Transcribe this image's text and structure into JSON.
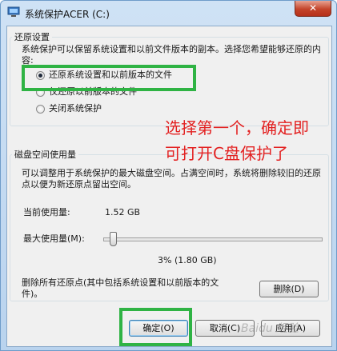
{
  "window": {
    "title": "系统保护ACER (C:)",
    "close_label": "✕"
  },
  "restore_group": {
    "title": "还原设置",
    "description": "系统保护可以保留系统设置和以前文件版本的副本。选择您希望能够还原的内容:",
    "options": [
      {
        "label": "还原系统设置和以前版本的文件",
        "checked": true
      },
      {
        "label": "仅还原以前版本的文件",
        "checked": false
      },
      {
        "label": "关闭系统保护",
        "checked": false
      }
    ]
  },
  "disk_group": {
    "title": "磁盘空间使用量",
    "description": "可以调整用于系统保护的最大磁盘空间。占满空间时，系统将删除较旧的还原点以便为新还原点留出空间。",
    "current_usage_label": "当前使用量:",
    "current_usage_value": "1.52 GB",
    "max_usage_label": "最大使用量(M):",
    "max_usage_fraction": 0.03,
    "max_usage_value": "3% (1.80 GB)"
  },
  "delete_section": {
    "text": "删除所有还原点(其中包括系统设置和以前版本的文件)。",
    "delete_button": "删除(D)"
  },
  "footer": {
    "ok_button": "确定(O)",
    "cancel_button": "取消(C)",
    "apply_button": "应用(A)"
  },
  "annotation": {
    "line1": "选择第一个，确定即",
    "line2": "可打开C盘保护了",
    "highlight_color": "#2fb344",
    "text_color": "#e32222"
  },
  "watermark": "Baidu 经验"
}
